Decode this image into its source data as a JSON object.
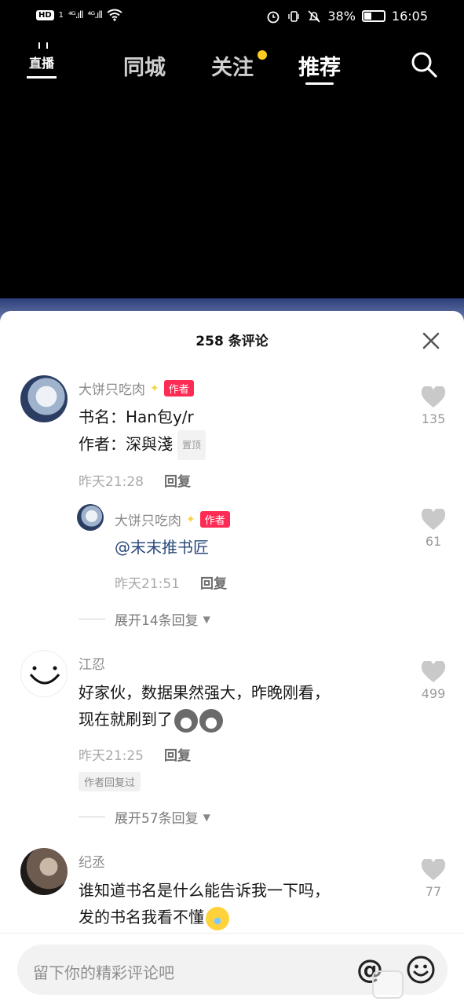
{
  "status_bar": {
    "hd": "HD",
    "sim": "1",
    "signal1": "⁴ᴳ.ıll",
    "signal2": "⁴ᴳ.ıll",
    "battery": "38%",
    "time": "16:05",
    "battery_level": 0.38
  },
  "top_nav": {
    "live_label": "直播",
    "tabs": [
      "同城",
      "关注",
      "推荐"
    ],
    "active_tab": "推荐"
  },
  "sheet": {
    "title": "258 条评论"
  },
  "comments": [
    {
      "name": "大饼只吃肉",
      "badge": "作者",
      "line1": "书名：Han包y/r",
      "line2": "作者：深與淺",
      "pinned": "置顶",
      "time": "昨天21:28",
      "reply": "回复",
      "likes": "135"
    },
    {
      "name": "大饼只吃肉",
      "badge": "作者",
      "text": "@末末推书匠",
      "time": "昨天21:51",
      "reply": "回复",
      "likes": "61"
    },
    {
      "name": "江忍",
      "line1": "好家伙，数据果然强大，昨晚刚看，",
      "line2": "现在就刷到了",
      "time": "昨天21:25",
      "reply": "回复",
      "author_replied": "作者回复过",
      "likes": "499"
    },
    {
      "name": "纪丞",
      "line1": "谁知道书名是什么能告诉我一下吗，",
      "line2": "发的书名我看不懂",
      "likes": "77"
    }
  ],
  "expand": {
    "first": "展开14条回复",
    "second": "展开57条回复"
  },
  "input": {
    "placeholder": "留下你的精彩评论吧",
    "at": "@"
  },
  "colors": {
    "accent": "#fe2c55",
    "follow_dot": "#ffcc22"
  }
}
